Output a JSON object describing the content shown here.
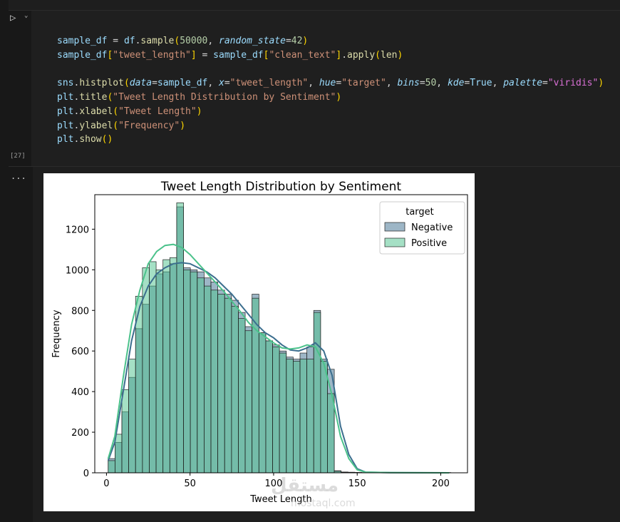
{
  "cell": {
    "execution_count": "[27]",
    "code_lines": [
      "sample_df = df.sample(50000, random_state=42)",
      "sample_df[\"tweet_length\"] = sample_df[\"clean_text\"].apply(len)",
      "",
      "sns.histplot(data=sample_df, x=\"tweet_length\", hue=\"target\", bins=50, kde=True, palette=\"viridis\")",
      "plt.title(\"Tweet Length Distribution by Sentiment\")",
      "plt.xlabel(\"Tweet Length\")",
      "plt.ylabel(\"Frequency\")",
      "plt.show()"
    ]
  },
  "output": {
    "more_label": "..."
  },
  "watermark": {
    "brand": "مستقل",
    "site": "mostaql.com"
  },
  "chart_data": {
    "type": "bar",
    "title": "Tweet Length Distribution by Sentiment",
    "xlabel": "Tweet Length",
    "ylabel": "Frequency",
    "xlim": [
      -7,
      216
    ],
    "ylim": [
      0,
      1370
    ],
    "xticks": [
      0,
      50,
      100,
      150,
      200
    ],
    "yticks": [
      0,
      200,
      400,
      600,
      800,
      1000,
      1200
    ],
    "legend": {
      "title": "target",
      "placement": "top-right"
    },
    "bin_edges_start": 1,
    "bin_width": 4.1,
    "series": [
      {
        "name": "Negative",
        "color": "#3b6e8e",
        "values": [
          70,
          150,
          300,
          470,
          710,
          830,
          920,
          980,
          990,
          1030,
          1310,
          1010,
          1000,
          990,
          960,
          940,
          900,
          880,
          850,
          790,
          720,
          880,
          690,
          650,
          630,
          600,
          570,
          560,
          590,
          620,
          800,
          560,
          510,
          10,
          4,
          3,
          2,
          1,
          1,
          1,
          1,
          1,
          1,
          1,
          1,
          1,
          1,
          1,
          1,
          1
        ],
        "kde": [
          [
            1,
            60
          ],
          [
            5,
            150
          ],
          [
            10,
            400
          ],
          [
            15,
            650
          ],
          [
            20,
            820
          ],
          [
            25,
            920
          ],
          [
            30,
            980
          ],
          [
            35,
            1010
          ],
          [
            40,
            1030
          ],
          [
            45,
            1035
          ],
          [
            50,
            1030
          ],
          [
            55,
            1010
          ],
          [
            60,
            990
          ],
          [
            65,
            960
          ],
          [
            70,
            920
          ],
          [
            75,
            880
          ],
          [
            80,
            830
          ],
          [
            85,
            780
          ],
          [
            90,
            730
          ],
          [
            95,
            690
          ],
          [
            100,
            665
          ],
          [
            105,
            630
          ],
          [
            110,
            605
          ],
          [
            115,
            600
          ],
          [
            120,
            615
          ],
          [
            125,
            640
          ],
          [
            130,
            600
          ],
          [
            135,
            480
          ],
          [
            140,
            230
          ],
          [
            145,
            90
          ],
          [
            150,
            20
          ],
          [
            155,
            3
          ],
          [
            170,
            1
          ],
          [
            205,
            0
          ]
        ]
      },
      {
        "name": "Positive",
        "color": "#4bc28b",
        "values": [
          60,
          190,
          410,
          560,
          870,
          1010,
          1040,
          1000,
          1050,
          1060,
          1330,
          1000,
          990,
          960,
          920,
          900,
          880,
          860,
          820,
          760,
          700,
          860,
          690,
          650,
          620,
          590,
          560,
          550,
          560,
          560,
          790,
          550,
          390,
          8,
          3,
          2,
          1,
          1,
          1,
          1,
          1,
          1,
          1,
          1,
          1,
          1,
          1,
          1,
          1,
          1
        ],
        "kde": [
          [
            1,
            70
          ],
          [
            5,
            180
          ],
          [
            10,
            470
          ],
          [
            15,
            730
          ],
          [
            20,
            900
          ],
          [
            25,
            1030
          ],
          [
            30,
            1090
          ],
          [
            35,
            1120
          ],
          [
            40,
            1125
          ],
          [
            45,
            1110
          ],
          [
            50,
            1075
          ],
          [
            55,
            1030
          ],
          [
            60,
            985
          ],
          [
            65,
            940
          ],
          [
            70,
            895
          ],
          [
            75,
            845
          ],
          [
            80,
            795
          ],
          [
            85,
            740
          ],
          [
            90,
            700
          ],
          [
            95,
            670
          ],
          [
            100,
            640
          ],
          [
            105,
            615
          ],
          [
            110,
            610
          ],
          [
            115,
            615
          ],
          [
            120,
            630
          ],
          [
            125,
            620
          ],
          [
            130,
            540
          ],
          [
            135,
            380
          ],
          [
            140,
            180
          ],
          [
            145,
            70
          ],
          [
            150,
            15
          ],
          [
            155,
            3
          ],
          [
            170,
            1
          ],
          [
            205,
            0
          ]
        ]
      }
    ]
  }
}
